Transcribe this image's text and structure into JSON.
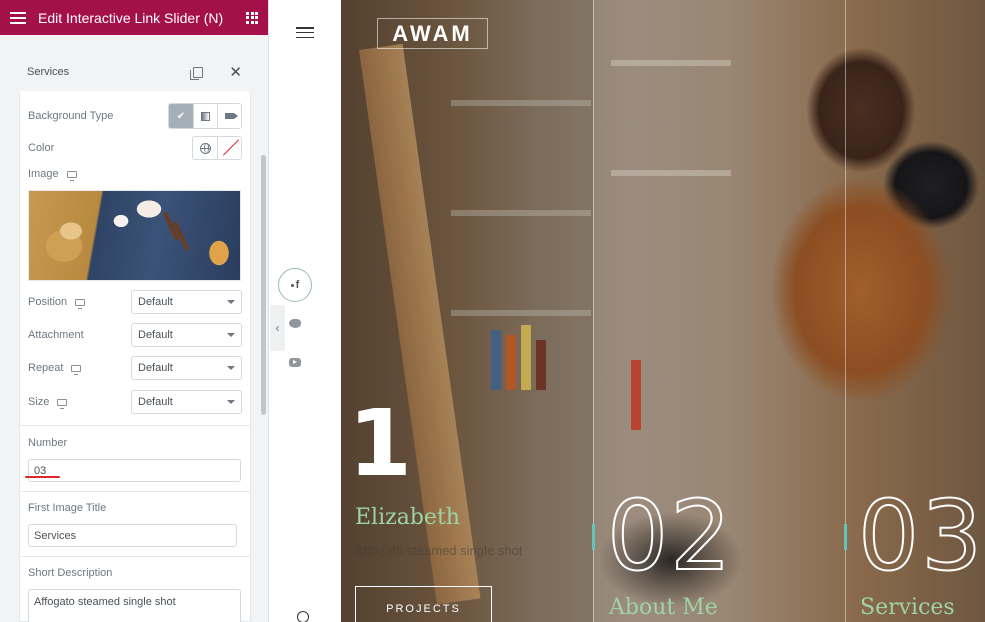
{
  "panel": {
    "header_title": "Edit Interactive Link Slider (N)",
    "section_title": "Services",
    "background_type_label": "Background Type",
    "color_label": "Color",
    "image_label": "Image",
    "position": {
      "label": "Position",
      "value": "Default"
    },
    "attachment": {
      "label": "Attachment",
      "value": "Default"
    },
    "repeat": {
      "label": "Repeat",
      "value": "Default"
    },
    "size": {
      "label": "Size",
      "value": "Default"
    },
    "number": {
      "label": "Number",
      "value": "03"
    },
    "first_image_title": {
      "label": "First Image Title",
      "value": "Services"
    },
    "short_description": {
      "label": "Short Description",
      "value": "Affogato steamed single shot"
    }
  },
  "hero": {
    "logo": "AWAM",
    "slides": [
      {
        "number": "1",
        "title": "Elizabeth",
        "description": "Affogato steamed single shot",
        "button": "PROJECTS"
      },
      {
        "number": "02",
        "title": "About Me"
      },
      {
        "number": "03",
        "title": "Services"
      }
    ]
  },
  "social": [
    "facebook-icon",
    "twitter-icon",
    "youtube-icon"
  ],
  "colors": {
    "brand": "#a4114a",
    "accent_teal": "#5fc6bd",
    "title_green": "#9ed3a6"
  }
}
